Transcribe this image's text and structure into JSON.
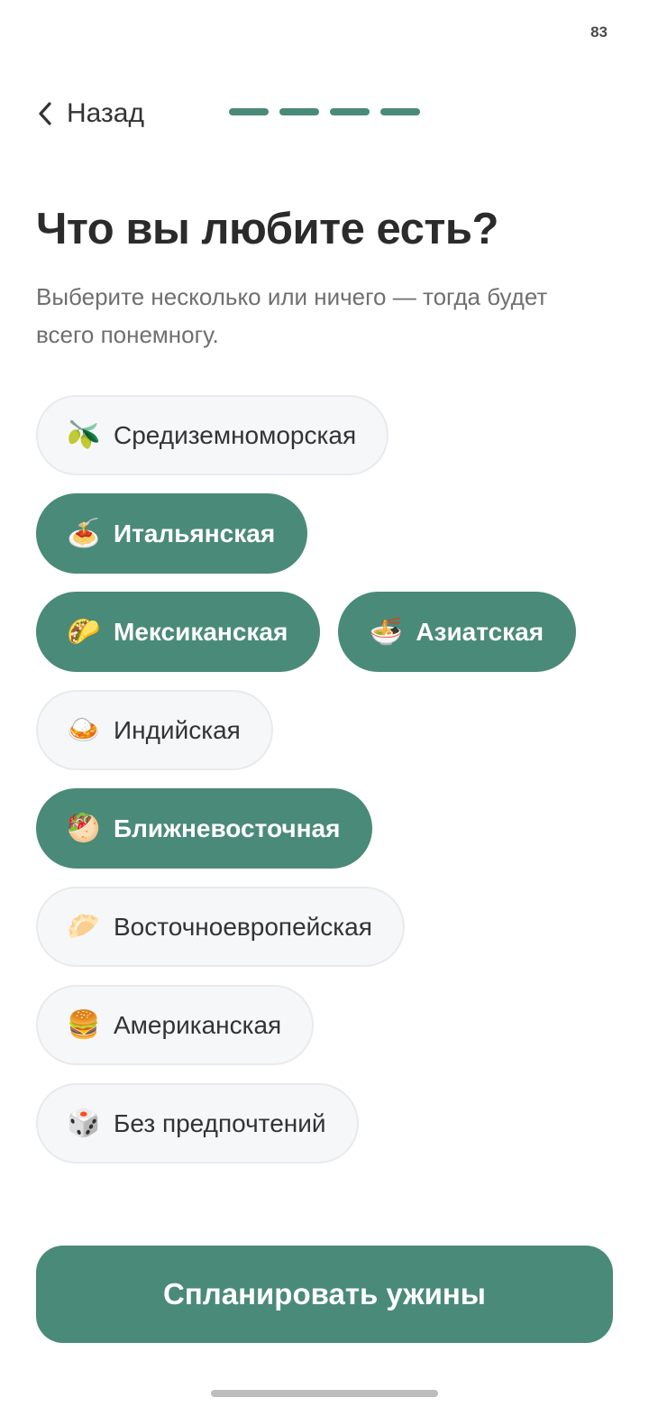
{
  "status_bar": {
    "battery": "83"
  },
  "header": {
    "back_label": "Назад",
    "progress_steps_total": 4,
    "progress_steps_done": 4
  },
  "title": "Что вы любите есть?",
  "subtitle": "Выберите несколько или ничего — тогда будет всего понемногу.",
  "cuisines": [
    {
      "icon": "🫒",
      "icon_name": "olive-icon",
      "label": "Средиземноморская",
      "selected": false
    },
    {
      "icon": "🍝",
      "icon_name": "spaghetti-icon",
      "label": "Итальянская",
      "selected": true
    },
    {
      "icon": "🌮",
      "icon_name": "taco-icon",
      "label": "Мексиканская",
      "selected": true
    },
    {
      "icon": "🍜",
      "icon_name": "noodle-bowl-icon",
      "label": "Азиатская",
      "selected": true
    },
    {
      "icon": "🍛",
      "icon_name": "curry-icon",
      "label": "Индийская",
      "selected": false
    },
    {
      "icon": "🥙",
      "icon_name": "flatbread-icon",
      "label": "Ближневосточная",
      "selected": true
    },
    {
      "icon": "🥟",
      "icon_name": "dumpling-icon",
      "label": "Восточноевропейская",
      "selected": false
    },
    {
      "icon": "🍔",
      "icon_name": "burger-icon",
      "label": "Американская",
      "selected": false
    },
    {
      "icon": "🎲",
      "icon_name": "dice-icon",
      "label": "Без предпочтений",
      "selected": false
    }
  ],
  "cta_label": "Спланировать ужины",
  "colors": {
    "accent": "#4a8a78",
    "chip_off_bg": "#f6f7f9",
    "chip_off_border": "#e8eaed"
  }
}
